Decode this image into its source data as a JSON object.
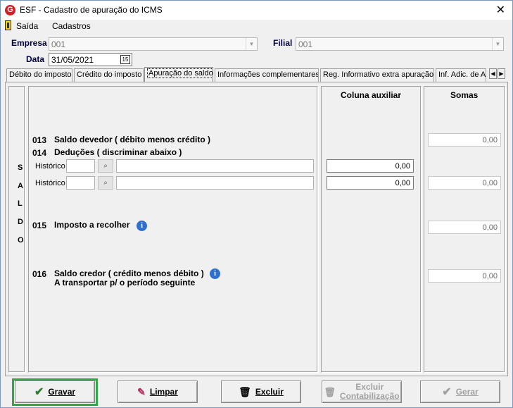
{
  "window": {
    "title": "ESF - Cadastro de apuração do ICMS",
    "close_glyph": "✕",
    "app_icon": "G"
  },
  "menu": {
    "items": [
      "Saída",
      "Cadastros"
    ]
  },
  "header": {
    "empresa_label": "Empresa",
    "empresa_value": "001",
    "filial_label": "Filial",
    "filial_value": "001",
    "data_label": "Data",
    "data_value": "31/05/2021"
  },
  "tabs": [
    "Débito do imposto",
    "Crédito do imposto",
    "Apuração do saldo",
    "Informações complementares",
    "Reg. Informativo extra apuração",
    "Inf. Adic. de A"
  ],
  "active_tab": "Apuração do saldo",
  "panel": {
    "side_letters": [
      "S",
      "A",
      "L",
      "D",
      "O"
    ],
    "col_aux": "Coluna auxiliar",
    "col_somas": "Somas",
    "r013_code": "013",
    "r013_text": "Saldo devedor ( débito menos crédito )",
    "r013_soma": "0,00",
    "r014_code": "014",
    "r014_text": "Deduções ( discriminar abaixo )",
    "hist_label": "Histórico",
    "hist1_aux": "0,00",
    "hist2_aux": "0,00",
    "hist2_soma": "0,00",
    "r015_code": "015",
    "r015_text": "Imposto a recolher",
    "r015_soma": "0,00",
    "r016_code": "016",
    "r016_text": "Saldo credor ( crédito menos débito )",
    "r016_text2": "A transportar p/ o período seguinte",
    "r016_soma": "0,00"
  },
  "buttons": {
    "gravar": "Gravar",
    "limpar": "Limpar",
    "excluir": "Excluir",
    "excluir_cont_1": "Excluir",
    "excluir_cont_2": "Contabilização",
    "gerar": "Gerar"
  },
  "colors": {
    "highlight": "#2ea84a",
    "info": "#2f6fd0"
  }
}
